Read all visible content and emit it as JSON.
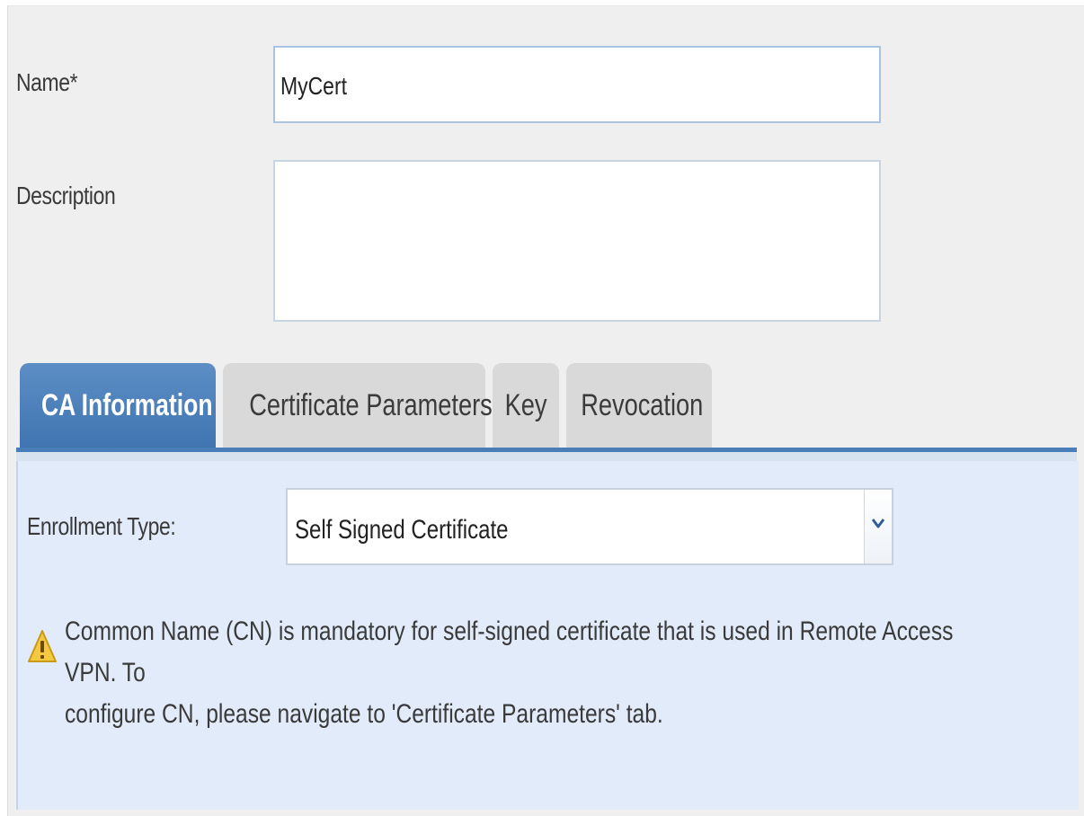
{
  "form": {
    "name_label": "Name*",
    "name_value": "MyCert",
    "description_label": "Description",
    "description_value": ""
  },
  "tabs": [
    {
      "label": "CA Information",
      "active": true
    },
    {
      "label": "Certificate Parameters",
      "active": false
    },
    {
      "label": "Key",
      "active": false
    },
    {
      "label": "Revocation",
      "active": false
    }
  ],
  "ca_information": {
    "enrollment_type_label": "Enrollment Type:",
    "enrollment_type_value": "Self Signed Certificate",
    "warning_line1": "Common Name (CN) is mandatory for self-signed certificate that is used in Remote Access VPN. To",
    "warning_line2": "configure CN, please navigate to 'Certificate Parameters' tab."
  },
  "icons": {
    "warning": "warning-icon",
    "dropdown": "chevron-down-icon"
  },
  "colors": {
    "active_tab": "#4a7eb8",
    "panel_background": "#e1ebf9",
    "dialog_background": "#efefef",
    "warning_yellow": "#f2c94c"
  }
}
